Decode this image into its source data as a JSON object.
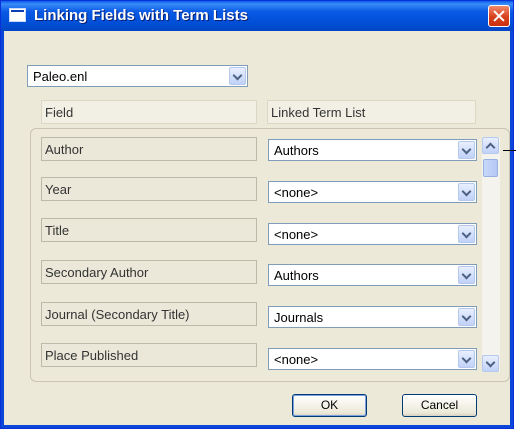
{
  "window": {
    "title": "Linking Fields with Term Lists"
  },
  "library_select": {
    "value": "Paleo.enl"
  },
  "columns": {
    "field": "Field",
    "term_list": "Linked Term List"
  },
  "rows": [
    {
      "field": "Author",
      "term_list": "Authors"
    },
    {
      "field": "Year",
      "term_list": "<none>"
    },
    {
      "field": "Title",
      "term_list": "<none>"
    },
    {
      "field": "Secondary Author",
      "term_list": "Authors"
    },
    {
      "field": "Journal (Secondary Title)",
      "term_list": "Journals"
    },
    {
      "field": "Place Published",
      "term_list": "<none>"
    }
  ],
  "buttons": {
    "ok": "OK",
    "cancel": "Cancel"
  },
  "colors": {
    "titlebar": "#0a5ae6",
    "dialog_bg": "#ece9d8",
    "close": "#d8401c"
  },
  "icons": [
    "app-window-icon",
    "close-icon",
    "chevron-down-icon",
    "scroll-up-arrow",
    "scroll-down-arrow"
  ]
}
